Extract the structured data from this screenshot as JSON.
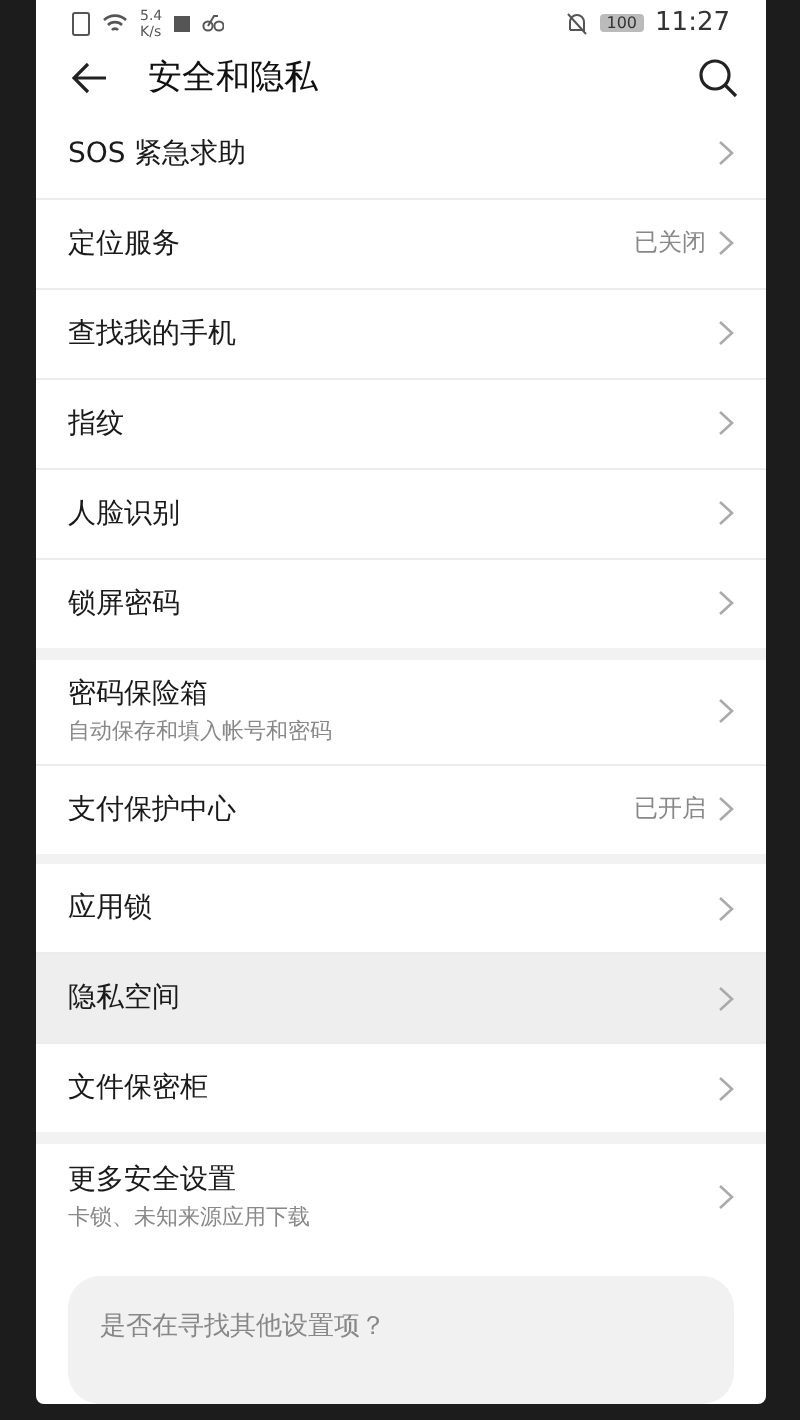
{
  "status_bar": {
    "net_speed_value": "5.4",
    "net_speed_unit": "K/s",
    "battery": "100",
    "time": "11:27"
  },
  "header": {
    "title": "安全和隐私"
  },
  "groups": [
    {
      "items": [
        {
          "label": "SOS 紧急求助",
          "pressed": false
        },
        {
          "label": "定位服务",
          "value": "已关闭",
          "pressed": false
        },
        {
          "label": "查找我的手机",
          "pressed": false
        },
        {
          "label": "指纹",
          "pressed": false
        },
        {
          "label": "人脸识别",
          "pressed": false
        },
        {
          "label": "锁屏密码",
          "pressed": false
        }
      ]
    },
    {
      "items": [
        {
          "label": "密码保险箱",
          "subtitle": "自动保存和填入帐号和密码",
          "pressed": false
        },
        {
          "label": "支付保护中心",
          "value": "已开启",
          "pressed": false
        }
      ]
    },
    {
      "items": [
        {
          "label": "应用锁",
          "pressed": false
        },
        {
          "label": "隐私空间",
          "pressed": true
        },
        {
          "label": "文件保密柜",
          "pressed": false
        }
      ]
    },
    {
      "items": [
        {
          "label": "更多安全设置",
          "subtitle": "卡锁、未知来源应用下载",
          "pressed": false
        }
      ]
    }
  ],
  "suggestion_card": {
    "question": "是否在寻找其他设置项？"
  }
}
